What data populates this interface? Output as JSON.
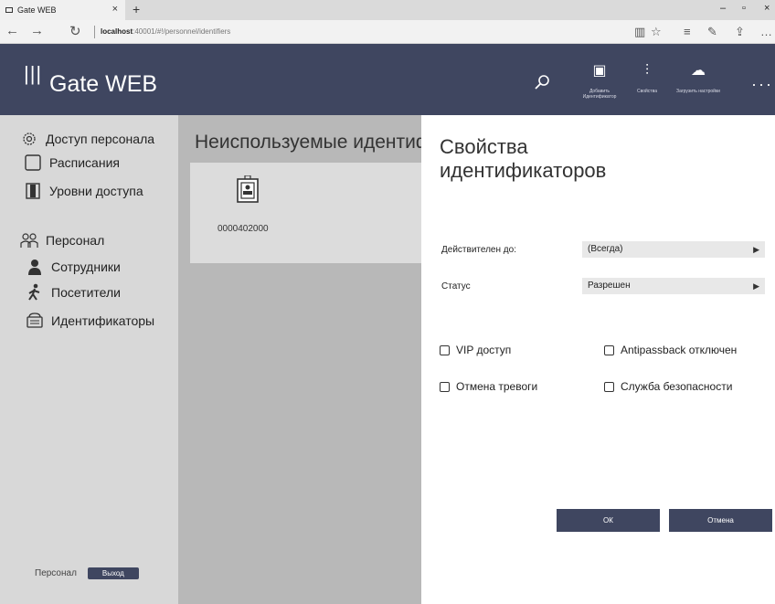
{
  "browser": {
    "tab_title": "Gate WEB",
    "tab_close": "×",
    "new_tab": "+",
    "url_host": "localhost",
    "url_rest": ":40001/#!/personnel/identifiers",
    "back": "←",
    "forward": "→",
    "refresh": "↻",
    "minimize": "–",
    "maximize": "▫",
    "close": "×"
  },
  "header": {
    "app_title": "Gate WEB",
    "buttons": [
      {
        "label": "Добавить Идентификатор",
        "icon": "add-identifier-icon"
      },
      {
        "label": "Свойства",
        "icon": "properties-icon"
      },
      {
        "label": "Загрузить настройки",
        "icon": "upload-settings-icon"
      }
    ],
    "more": "···"
  },
  "sidebar": {
    "sections": [
      {
        "label": "Доступ персонала",
        "icon": "gear-icon"
      },
      {
        "label": "Расписания",
        "icon": "calendar-icon"
      },
      {
        "label": "Уровни доступа",
        "icon": "door-icon"
      },
      {
        "label": "Персонал",
        "icon": "people-icon"
      },
      {
        "label": "Сотрудники",
        "icon": "employee-icon"
      },
      {
        "label": "Посетители",
        "icon": "visitor-icon"
      },
      {
        "label": "Идентификаторы",
        "icon": "identifier-icon"
      }
    ],
    "footer_label": "Персонал",
    "logout": "Выход"
  },
  "main": {
    "title": "Неиспользуемые идентификаторы",
    "cards": [
      {
        "code": "0000402000"
      }
    ]
  },
  "panel": {
    "title": "Свойства идентификаторов",
    "valid_until_label": "Действителен до:",
    "valid_until_value": "(Всегда)",
    "status_label": "Статус",
    "status_value": "Разрешен",
    "checkboxes": [
      {
        "label": "VIP доступ",
        "checked": false
      },
      {
        "label": "Antipassback отключен",
        "checked": false
      },
      {
        "label": "Отмена тревоги",
        "checked": false
      },
      {
        "label": "Служба безопасности",
        "checked": false
      }
    ],
    "ok": "ОК",
    "cancel": "Отмена"
  },
  "colors": {
    "header_bg": "#3f4660",
    "sidebar_bg": "#d8d8d8",
    "main_bg": "#b8b8b8"
  }
}
